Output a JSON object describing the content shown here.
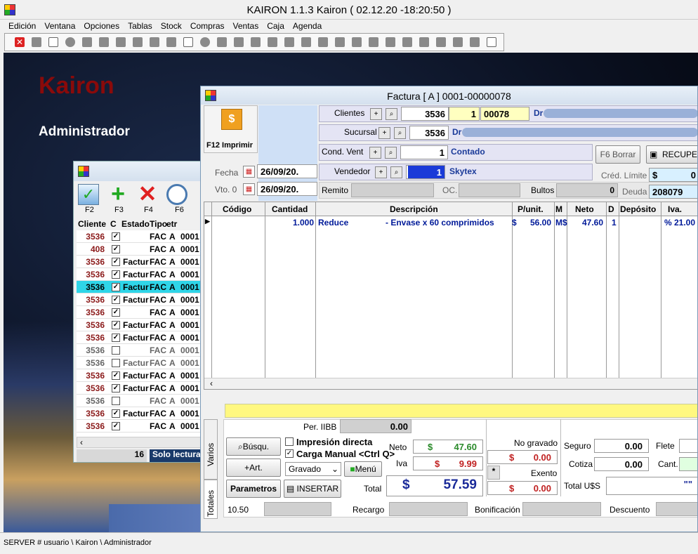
{
  "app": {
    "title": "KAIRON 1.1.3   Kairon  ( 02.12.20       -18:20:50 )"
  },
  "menu": [
    "Edición",
    "Ventana",
    "Opciones",
    "Tablas",
    "Stock",
    "Compras",
    "Ventas",
    "Caja",
    "Agenda"
  ],
  "desktop": {
    "brand": "Kairon",
    "role": "Administrador"
  },
  "status": "SERVER # usuario \\ Kairon \\ Administrador",
  "list": {
    "fkeys": [
      "F2",
      "F3",
      "F4",
      "F6"
    ],
    "columns": [
      "Cliente",
      "C",
      "Estado",
      "Tipo",
      "etr"
    ],
    "rows": [
      {
        "c": "3536",
        "chk": "✓",
        "e": "",
        "t": "FAC",
        "l": "A",
        "n": "0001",
        "dim": false
      },
      {
        "c": "408",
        "chk": "✓",
        "e": "",
        "t": "FAC",
        "l": "A",
        "n": "0001",
        "dim": false
      },
      {
        "c": "3536",
        "chk": "✓",
        "e": "Factur",
        "t": "FAC",
        "l": "A",
        "n": "0001",
        "dim": false
      },
      {
        "c": "3536",
        "chk": "✓",
        "e": "Factur",
        "t": "FAC",
        "l": "A",
        "n": "0001",
        "dim": false
      },
      {
        "c": "3536",
        "chk": "✓",
        "e": "Factur",
        "t": "FAC",
        "l": "A",
        "n": "0001",
        "dim": false,
        "sel": true
      },
      {
        "c": "3536",
        "chk": "✓",
        "e": "Factur",
        "t": "FAC",
        "l": "A",
        "n": "0001",
        "dim": false
      },
      {
        "c": "3536",
        "chk": "✓",
        "e": "",
        "t": "FAC",
        "l": "A",
        "n": "0001",
        "dim": false
      },
      {
        "c": "3536",
        "chk": "✓",
        "e": "Factur",
        "t": "FAC",
        "l": "A",
        "n": "0001",
        "dim": false
      },
      {
        "c": "3536",
        "chk": "✓",
        "e": "Factur",
        "t": "FAC",
        "l": "A",
        "n": "0001",
        "dim": false
      },
      {
        "c": "3536",
        "chk": "",
        "e": "",
        "t": "FAC",
        "l": "A",
        "n": "0001",
        "dim": true
      },
      {
        "c": "3536",
        "chk": "",
        "e": "Factur",
        "t": "FAC",
        "l": "A",
        "n": "0001",
        "dim": true
      },
      {
        "c": "3536",
        "chk": "✓",
        "e": "Factur",
        "t": "FAC",
        "l": "A",
        "n": "0001",
        "dim": false
      },
      {
        "c": "3536",
        "chk": "✓",
        "e": "Factur",
        "t": "FAC",
        "l": "A",
        "n": "0001",
        "dim": false
      },
      {
        "c": "3536",
        "chk": "",
        "e": "",
        "t": "FAC",
        "l": "A",
        "n": "0001",
        "dim": true
      },
      {
        "c": "3536",
        "chk": "✓",
        "e": "Factur",
        "t": "FAC",
        "l": "A",
        "n": "0001",
        "dim": false
      },
      {
        "c": "3536",
        "chk": "✓",
        "e": "",
        "t": "FAC",
        "l": "A",
        "n": "0001",
        "dim": false
      }
    ],
    "count": "16",
    "mode": "Solo lectura"
  },
  "factura": {
    "title": "Factura [ A ] 0001-00000078",
    "print_label": "F12 Imprimir",
    "labels": {
      "clientes": "Clientes",
      "sucursal": "Sucursal",
      "cond_vent": "Cond. Vent",
      "vendedor": "Vendedor",
      "fecha": "Fecha",
      "vto": "Vto. 0",
      "remito": "Remito",
      "oc": "OC.",
      "bultos": "Bultos",
      "cred_limite": "Créd. Límite",
      "deuda": "Deuda"
    },
    "clientes": {
      "code": "3536",
      "n": "1",
      "num": "00078",
      "name_prefix": "Dr"
    },
    "sucursal": {
      "code": "3536",
      "name_prefix": "Dr"
    },
    "cond_vent": {
      "code": "1",
      "name": "Contado"
    },
    "vendedor": {
      "code": "1",
      "name": "Skytex"
    },
    "fecha": "26/09/20.",
    "vto": "26/09/20.",
    "bultos": "0",
    "f6": "F6 Borrar",
    "recupe": "RECUPE",
    "cred_limite": {
      "cur": "$",
      "val": "0"
    },
    "deuda": "208079",
    "grid": {
      "headers": [
        "Código",
        "Cantidad",
        "Descripción",
        "P/unit.",
        "M",
        "Neto",
        "D",
        "Depósito",
        "Iva."
      ],
      "row": {
        "cantidad": "1.000",
        "desc1": "Reduce",
        "desc2": "- Envase x 60 comprimidos",
        "pcur": "$",
        "punit": "56.00",
        "m": "M$",
        "neto": "47.60",
        "d": "1",
        "iva": "% 21.00"
      }
    },
    "bottom": {
      "per_iibb_label": "Per. IIBB",
      "per_iibb": "0.00",
      "busqu": "Búsqu.",
      "art": "Art.",
      "parametros": "Parametros",
      "insertar": "INSERTAR",
      "imp_directa": "Impresión directa",
      "carga_manual": "Carga Manual <Ctrl Q>",
      "gravado": "Gravado",
      "menu": "Menú",
      "neto_label": "Neto",
      "neto_cur": "$",
      "neto": "47.60",
      "iva_label": "Iva",
      "iva_cur": "$",
      "iva": "9.99",
      "total_label": "Total",
      "total_cur": "$",
      "total": "57.59",
      "no_gravado": "No gravado",
      "no_gravado_cur": "$",
      "no_gravado_val": "0.00",
      "exento": "Exento",
      "exento_cur": "$",
      "exento_val": "0.00",
      "seguro": "Seguro",
      "seguro_val": "0.00",
      "cotiza": "Cotiza",
      "cotiza_val": "0.00",
      "flete": "Flete",
      "cant": "Cant.",
      "total_us": "Total U$S",
      "total_us_val": "\"\"",
      "recargo": "Recargo",
      "bonificacion": "Bonificación",
      "descuento": "Descuento",
      "bottom_val": "10.50",
      "tab_varios": "Varios",
      "tab_totales": "Totales"
    }
  }
}
